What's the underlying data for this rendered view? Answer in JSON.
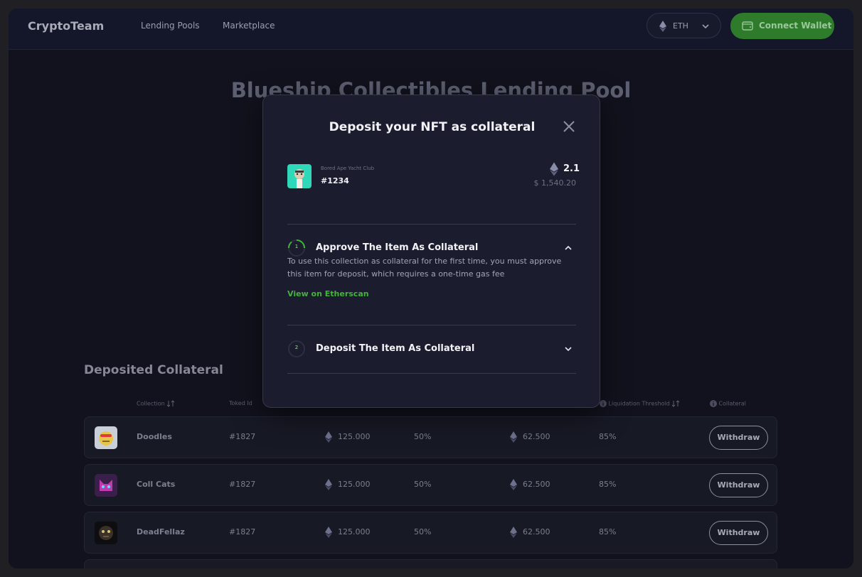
{
  "header": {
    "brand": "CryptoTeam",
    "nav": [
      "Lending Pools",
      "Marketplace"
    ],
    "network_label": "ETH",
    "connect_label": "Connect Wallet"
  },
  "page": {
    "title": "Blueship Collectibles Lending Pool",
    "section_title": "Deposited Collateral"
  },
  "table": {
    "headers": {
      "collection": "Collection",
      "token_id": "Toked Id",
      "liquidation_threshold": "Liquidation Threshold",
      "collateral": "Collateral"
    },
    "rows": [
      {
        "collection": "Doodles",
        "token_id": "#1827",
        "value": "125.000",
        "ltv": "50%",
        "borrow": "62.500",
        "threshold": "85%",
        "action": "Withdraw"
      },
      {
        "collection": "Coll Cats",
        "token_id": "#1827",
        "value": "125.000",
        "ltv": "50%",
        "borrow": "62.500",
        "threshold": "85%",
        "action": "Withdraw"
      },
      {
        "collection": "DeadFellaz",
        "token_id": "#1827",
        "value": "125.000",
        "ltv": "50%",
        "borrow": "62.500",
        "threshold": "85%",
        "action": "Withdraw"
      }
    ]
  },
  "modal": {
    "title": "Deposit your NFT as collateral",
    "nft": {
      "collection": "Bored Ape Yacht Club",
      "id": "#1234",
      "price": "2.1",
      "usd": "$ 1,540.20"
    },
    "steps": [
      {
        "number": "1",
        "title": "Approve The Item As Collateral",
        "description": "To use this collection as collateral for the first time, you must approve this item for deposit, which requires a one-time gas fee",
        "link": "View on Etherscan",
        "expanded": true
      },
      {
        "number": "2",
        "title": "Deposit The Item As Collateral",
        "expanded": false
      }
    ]
  },
  "colors": {
    "accent_green": "#43b33a",
    "connect_button": "#2e7b2b",
    "background": "#11121d",
    "modal": "#1b1d2e"
  }
}
